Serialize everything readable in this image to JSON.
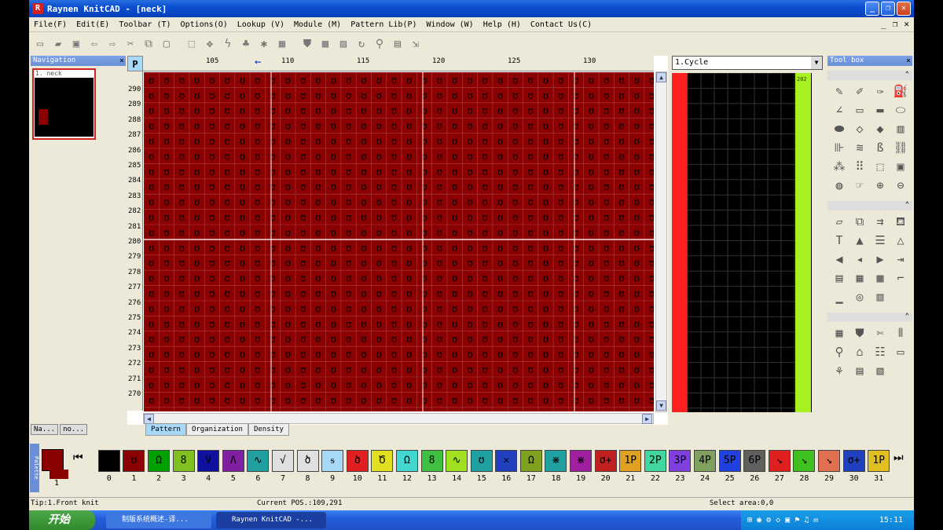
{
  "window": {
    "title": "Raynen KnitCAD - [neck]",
    "app_icon_letter": "R"
  },
  "menu": [
    "File(F)",
    "Edit(E)",
    "Toolbar (T)",
    "Options(O)",
    "Lookup (V)",
    "Module (M)",
    "Pattern Lib(P)",
    "Window (W)",
    "Help (H)",
    "Contact Us(C)"
  ],
  "navigation": {
    "title": "Navigation",
    "close": "×",
    "thumb_label": "1. neck",
    "tabs": [
      "Na...",
      "no..."
    ]
  },
  "editor": {
    "corner": "P",
    "arrow": "←",
    "columns": [
      {
        "label": "105"
      },
      {
        "label": "110"
      },
      {
        "label": "115"
      },
      {
        "label": "120"
      },
      {
        "label": "125"
      },
      {
        "label": "130"
      }
    ],
    "rows": [
      {
        "label": "290"
      },
      {
        "label": "289"
      },
      {
        "label": "288"
      },
      {
        "label": "287"
      },
      {
        "label": "286"
      },
      {
        "label": "285"
      },
      {
        "label": "284"
      },
      {
        "label": "283"
      },
      {
        "label": "282"
      },
      {
        "label": "281"
      },
      {
        "label": "280"
      },
      {
        "label": "279"
      },
      {
        "label": "278"
      },
      {
        "label": "277"
      },
      {
        "label": "276"
      },
      {
        "label": "275"
      },
      {
        "label": "274"
      },
      {
        "label": "273"
      },
      {
        "label": "272"
      },
      {
        "label": "271"
      },
      {
        "label": "270"
      }
    ],
    "tabs": [
      "Pattern",
      "Organization",
      "Density"
    ],
    "active_tab": "Pattern",
    "cell_color": "#8b0000"
  },
  "cycle": {
    "selected": "1.Cycle",
    "green_value": "202"
  },
  "toolbox": {
    "title": "Tool box",
    "close": "×"
  },
  "palette": {
    "current_value": "1",
    "swatches": [
      {
        "num": "0",
        "color": "#000000",
        "glyph": ""
      },
      {
        "num": "1",
        "color": "#8b0000",
        "glyph": "ʊ"
      },
      {
        "num": "2",
        "color": "#00a000",
        "glyph": "Ω"
      },
      {
        "num": "3",
        "color": "#80c020",
        "glyph": "8"
      },
      {
        "num": "4",
        "color": "#1010a0",
        "glyph": "V"
      },
      {
        "num": "5",
        "color": "#8020a0",
        "glyph": "Λ"
      },
      {
        "num": "6",
        "color": "#20a0a0",
        "glyph": "∿"
      },
      {
        "num": "7",
        "color": "#e0e0e0",
        "glyph": "√"
      },
      {
        "num": "8",
        "color": "#e0e0e0",
        "glyph": "ծ"
      },
      {
        "num": "9",
        "color": "#a8d8f8",
        "glyph": "ᵴ"
      },
      {
        "num": "10",
        "color": "#e02020",
        "glyph": "ծ"
      },
      {
        "num": "11",
        "color": "#e0e020",
        "glyph": "Ծ"
      },
      {
        "num": "12",
        "color": "#40d8d0",
        "glyph": "Ω"
      },
      {
        "num": "13",
        "color": "#40c040",
        "glyph": "8"
      },
      {
        "num": "14",
        "color": "#a0e020",
        "glyph": "∿"
      },
      {
        "num": "15",
        "color": "#20a0a0",
        "glyph": "ʊ"
      },
      {
        "num": "16",
        "color": "#2040c0",
        "glyph": "✕"
      },
      {
        "num": "17",
        "color": "#80a020",
        "glyph": "Ω"
      },
      {
        "num": "18",
        "color": "#20a0a0",
        "glyph": "⋇"
      },
      {
        "num": "19",
        "color": "#a020a0",
        "glyph": "⋇"
      },
      {
        "num": "20",
        "color": "#c02020",
        "glyph": "σ+"
      },
      {
        "num": "21",
        "color": "#e0a020",
        "glyph": "1P"
      },
      {
        "num": "22",
        "color": "#40d8a0",
        "glyph": "2P"
      },
      {
        "num": "23",
        "color": "#8040e0",
        "glyph": "3P"
      },
      {
        "num": "24",
        "color": "#80a060",
        "glyph": "4P"
      },
      {
        "num": "25",
        "color": "#2040e0",
        "glyph": "5P"
      },
      {
        "num": "26",
        "color": "#606060",
        "glyph": "6P"
      },
      {
        "num": "27",
        "color": "#e02020",
        "glyph": "↘"
      },
      {
        "num": "28",
        "color": "#40c020",
        "glyph": "↘"
      },
      {
        "num": "29",
        "color": "#e07050",
        "glyph": "↘"
      },
      {
        "num": "30",
        "color": "#2040c0",
        "glyph": "σ+"
      },
      {
        "num": "31",
        "color": "#e0c020",
        "glyph": "1P"
      }
    ]
  },
  "status": {
    "tip": "Tip:1.Front knit",
    "pos": "Current POS.:109,291",
    "area": "Select area:0,0"
  },
  "taskbar": {
    "start": "开始",
    "tasks": [
      "制版系统概述-译...",
      "Raynen KnitCAD -..."
    ],
    "time": "15:11"
  }
}
